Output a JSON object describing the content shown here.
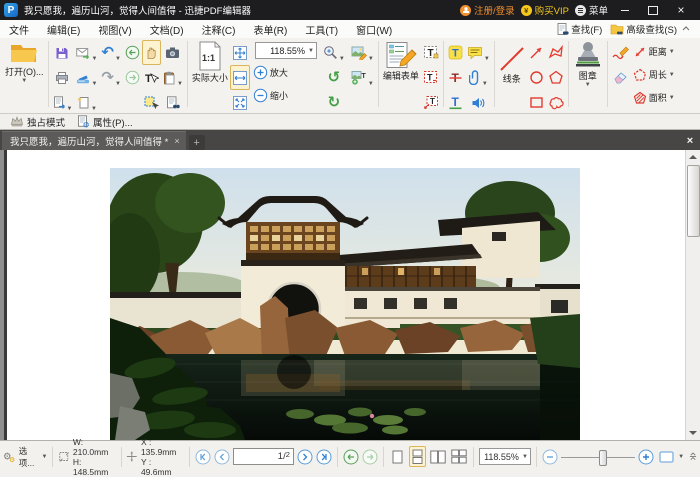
{
  "titlebar": {
    "title": "我只愿我，遍历山河，觉得人间值得 - 迅捷PDF编辑器",
    "logo_letter": "P",
    "login": "注册/登录",
    "vip": "购买VIP",
    "menu": "菜单"
  },
  "menubar": {
    "items": [
      "文件",
      "编辑(E)",
      "视图(V)",
      "文档(D)",
      "注释(C)",
      "表单(R)",
      "工具(T)",
      "窗口(W)"
    ]
  },
  "findbar": {
    "find": "查找(F)",
    "advanced": "高级查找(S)"
  },
  "toolbar": {
    "open": "打开(O)...",
    "actual_size": "实际大小",
    "zoom_value": "118.55%",
    "zoom_in": "放大",
    "zoom_out": "缩小",
    "edit_form": "编辑表单",
    "line": "线条",
    "stamp": "图章",
    "distance": "距离",
    "perimeter": "周长",
    "area": "面积"
  },
  "modebar": {
    "exclusive": "独占模式",
    "properties": "属性(P)..."
  },
  "tabbar": {
    "active_tab": "我只愿我，遍历山河，觉得人间值得 *",
    "close": "×",
    "new_tab": "+",
    "close_all": "×"
  },
  "statusbar": {
    "options": "选项...",
    "size_w": "W: 210.0mm",
    "size_h": "H: 148.5mm",
    "pos_x": "X : 135.9mm",
    "pos_y": "Y :  49.6mm",
    "page_current": "1",
    "page_sep": "/",
    "page_total": "2",
    "zoom_value": "118.55%"
  },
  "icons": {
    "undo": "↶",
    "redo": "↷",
    "rotate_left": "↺",
    "rotate_right": "↻",
    "gear": "⚙",
    "yen": "¥",
    "one_to_one": "1:1",
    "letter_t": "T"
  },
  "colors": {
    "accent_blue": "#2f7fd3",
    "annotation_red": "#e23b2e",
    "vip_yellow": "#f5c81d",
    "login_orange": "#f08f2e",
    "selected_bg": "#fdf3d0",
    "titlebar_bg": "#1d1d1f",
    "tabbar_bg": "#474645"
  }
}
